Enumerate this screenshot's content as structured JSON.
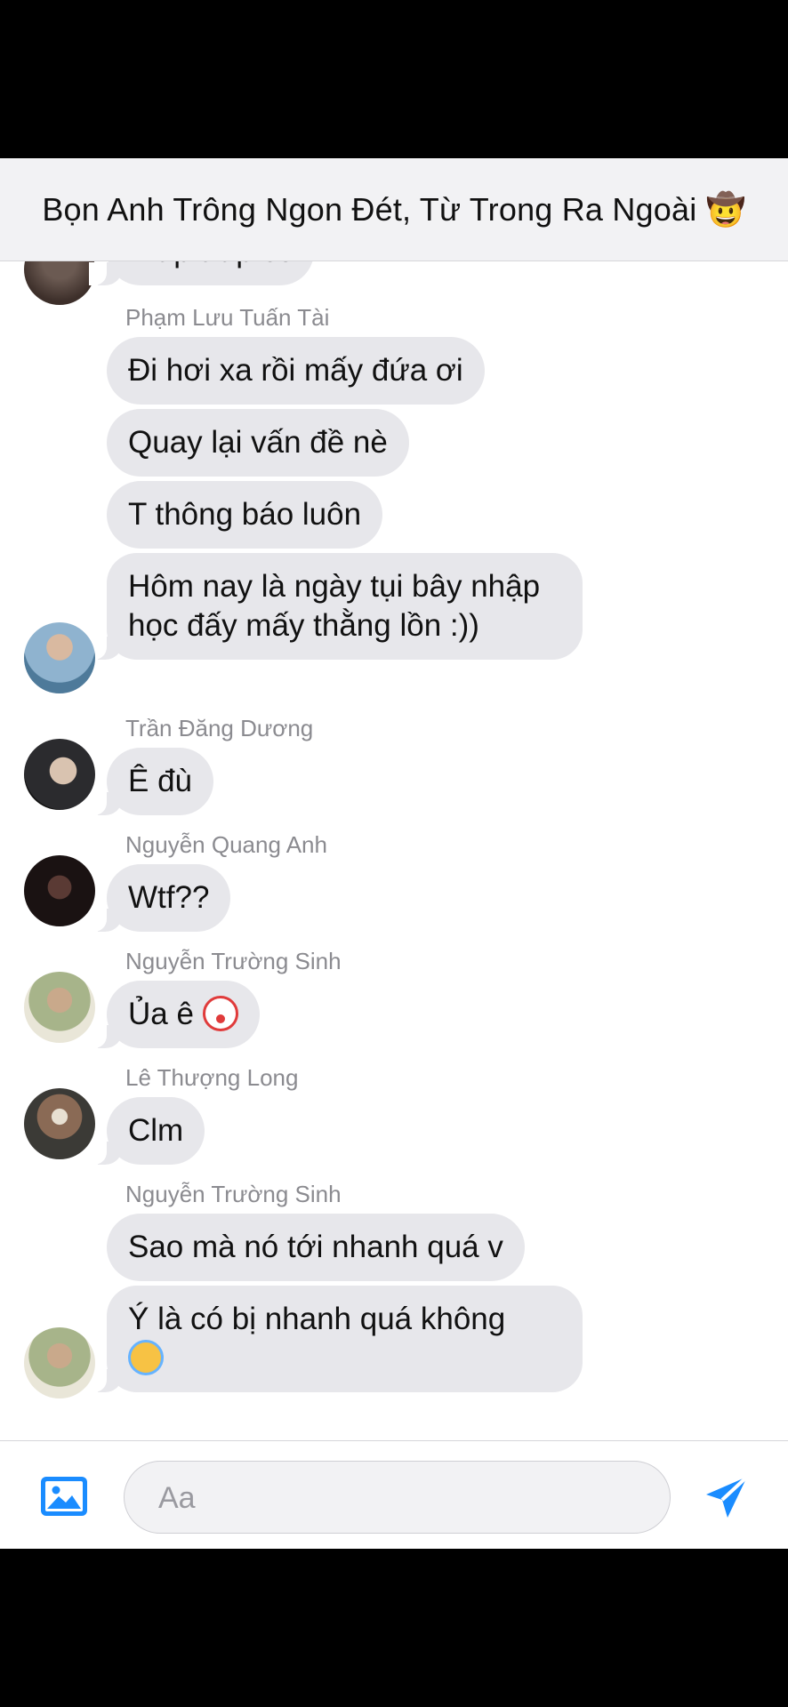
{
  "header": {
    "title": "Bọn Anh Trông Ngon Đét, Từ Trong Ra Ngoài 🤠"
  },
  "messages": {
    "partial_top": "Trap trap cc",
    "senders": {
      "s1": "Phạm Lưu Tuấn Tài",
      "s2": "Trần Đăng Dương",
      "s3": "Nguyễn Quang Anh",
      "s4": "Nguyễn Trường Sinh",
      "s5": "Lê Thượng Long",
      "s6": "Nguyễn Trường Sinh"
    },
    "m1": "Đi hơi xa rồi mấy đứa ơi",
    "m2": "Quay lại vấn đề nè",
    "m3": "T thông báo luôn",
    "m4": "Hôm nay là ngày tụi bây nhập học đấy mấy thằng lồn :))",
    "m5": "Ê đù",
    "m6": "Wtf??",
    "m7": "Ủa ê",
    "m8": "Clm",
    "m9": "Sao mà nó tới nhanh quá v",
    "m10": "Ý là có bị nhanh quá không"
  },
  "icons": {
    "clown": "clown-face-emoji",
    "angel": "smiling-face-with-halo-emoji",
    "photo": "photo-icon",
    "send": "send-icon"
  },
  "composer": {
    "placeholder": "Aa"
  },
  "colors": {
    "accent": "#1a8cff",
    "bubble": "#e7e7eb",
    "header_bg": "#f2f2f4"
  }
}
